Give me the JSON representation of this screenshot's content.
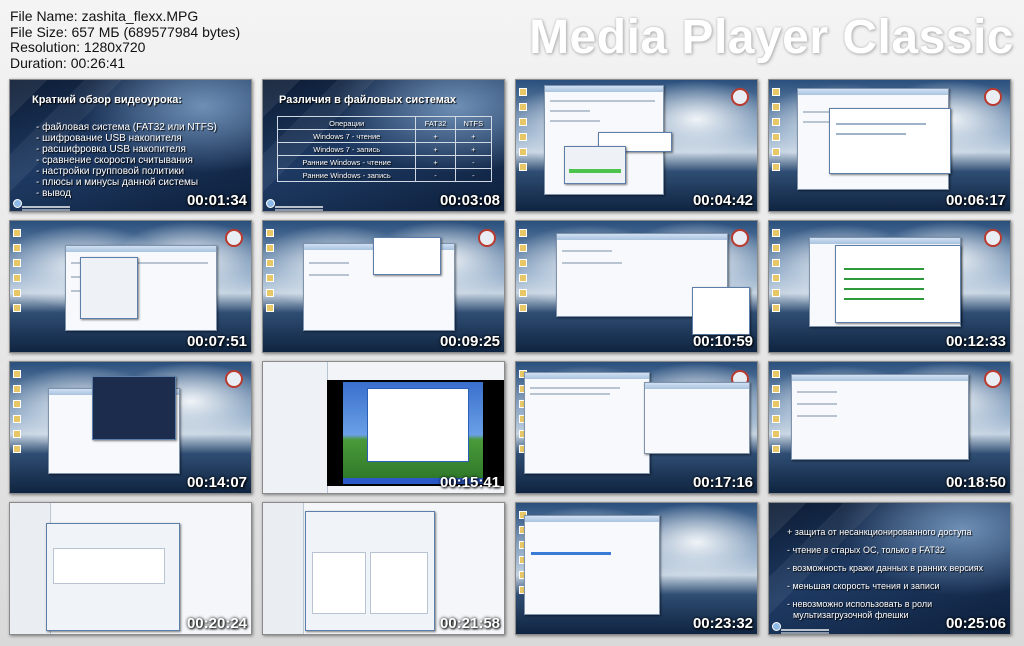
{
  "info": {
    "file_name": "File Name: zashita_flexx.MPG",
    "file_size": "File Size: 657 МБ (689577984 bytes)",
    "resolution": "Resolution: 1280x720",
    "duration": "Duration: 00:26:41"
  },
  "brand": "Media Player Classic",
  "thumbnails": [
    {
      "time": "00:01:34",
      "kind": "slide-list"
    },
    {
      "time": "00:03:08",
      "kind": "slide-table"
    },
    {
      "time": "00:04:42",
      "kind": "desktop"
    },
    {
      "time": "00:06:17",
      "kind": "desktop"
    },
    {
      "time": "00:07:51",
      "kind": "desktop"
    },
    {
      "time": "00:09:25",
      "kind": "desktop"
    },
    {
      "time": "00:10:59",
      "kind": "desktop"
    },
    {
      "time": "00:12:33",
      "kind": "desktop"
    },
    {
      "time": "00:14:07",
      "kind": "desktop"
    },
    {
      "time": "00:15:41",
      "kind": "xp-vm"
    },
    {
      "time": "00:17:16",
      "kind": "desktop"
    },
    {
      "time": "00:18:50",
      "kind": "desktop"
    },
    {
      "time": "00:20:24",
      "kind": "editor"
    },
    {
      "time": "00:21:58",
      "kind": "editor"
    },
    {
      "time": "00:23:32",
      "kind": "desktop"
    },
    {
      "time": "00:25:06",
      "kind": "slide-list2"
    }
  ],
  "slide1": {
    "title": "Краткий обзор видеоурока:",
    "bullets": [
      "- файловая система (FAT32 или NTFS)",
      "- шифрование USB накопителя",
      "- расшифровка USB накопителя",
      "- сравнение скорости считывания",
      "- настройки групповой политики",
      "- плюсы и минусы данной системы",
      "- вывод"
    ]
  },
  "slide2": {
    "title": "Различия в файловых системах",
    "headers": [
      "Операции",
      "FAT32",
      "NTFS"
    ],
    "rows": [
      [
        "Windows 7 - чтение",
        "+",
        "+"
      ],
      [
        "Windows 7 - запись",
        "+",
        "+"
      ],
      [
        "Ранние Windows - чтение",
        "+",
        "-"
      ],
      [
        "Ранние Windows - запись",
        "-",
        "-"
      ]
    ]
  },
  "slide16": {
    "bullets": [
      "+ защита от несанкционированного доступа",
      "- чтение в старых ОС, только в FAT32",
      "- возможность кражи данных в ранних версиях",
      "- меньшая скорость чтения и записи",
      "- невозможно использовать в роли",
      "мультизагрузочной флешки"
    ]
  }
}
